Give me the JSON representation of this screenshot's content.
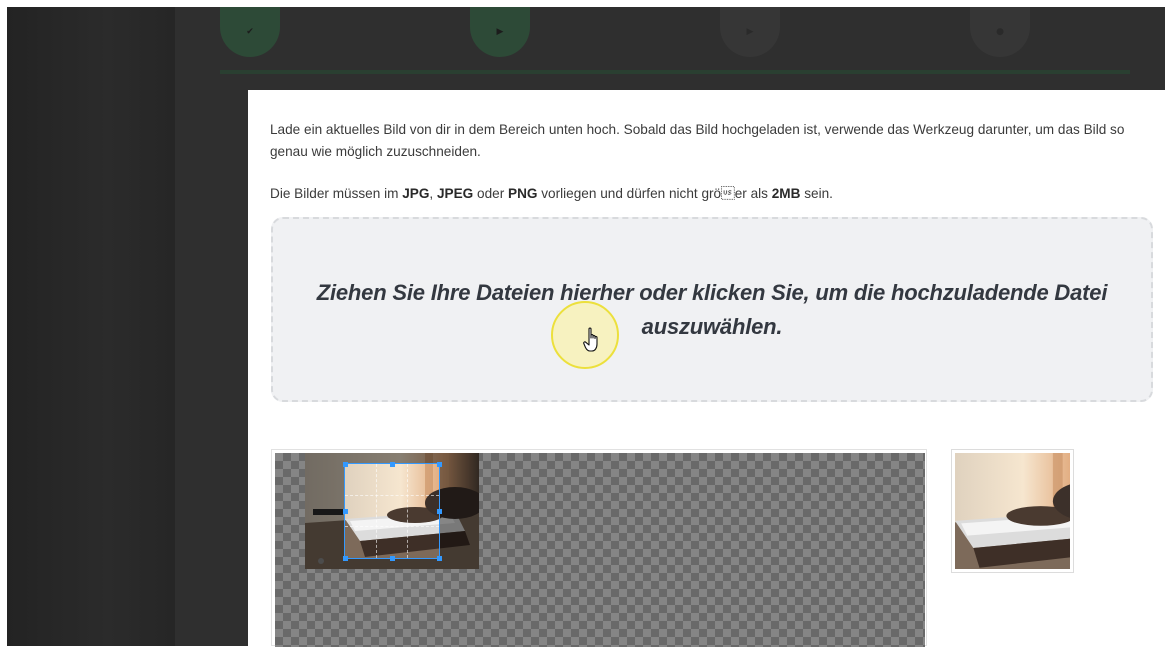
{
  "instructions": {
    "intro": "Lade ein aktuelles Bild von dir in dem Bereich unten hoch. Sobald das Bild hochgeladen ist, verwende das Werkzeug darunter, um das Bild so genau wie möglich zuzuschneiden.",
    "formats_prefix": "Die Bilder müssen im ",
    "format_jpg": "JPG",
    "sep1": ", ",
    "format_jpeg": "JPEG",
    "sep2": " oder ",
    "format_png": "PNG",
    "formats_middle": " vorliegen und dürfen nicht grö\u001fer als ",
    "max_size": "2MB",
    "formats_suffix": " sein."
  },
  "dropzone": {
    "text": "Ziehen Sie Ihre Dateien hierher oder klicken Sie, um die hochzuladende Datei auszuwählen."
  },
  "steps": [
    {
      "icon": "check-icon",
      "state": "done"
    },
    {
      "icon": "play-icon",
      "state": "current"
    },
    {
      "icon": "play-icon",
      "state": "idle"
    },
    {
      "icon": "circle-icon",
      "state": "idle"
    }
  ],
  "colors": {
    "accent_dark_green": "#2d4a37",
    "crop_handle_blue": "#3399ff",
    "cursor_highlight": "#ece03c",
    "dropzone_bg": "#f0f1f3"
  }
}
